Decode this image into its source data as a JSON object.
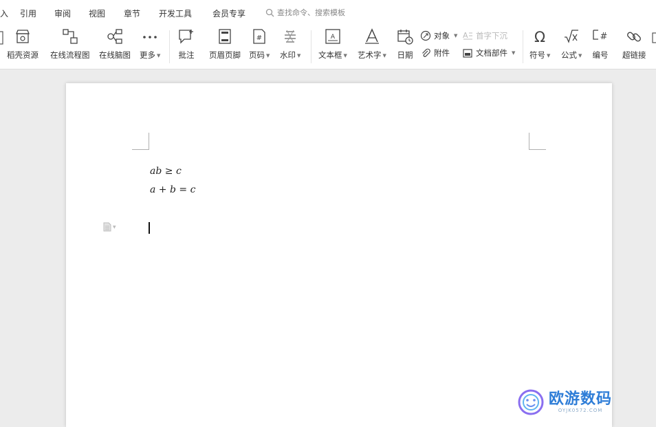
{
  "menu": {
    "items": [
      "引用",
      "审阅",
      "视图",
      "章节",
      "开发工具",
      "会员专享"
    ],
    "search_placeholder": "查找命令、搜索模板"
  },
  "ribbon": {
    "tools": [
      {
        "label": "稻壳资源",
        "icon": "template-store-icon"
      },
      {
        "label": "在线流程图",
        "icon": "flowchart-icon"
      },
      {
        "label": "在线脑图",
        "icon": "mindmap-icon"
      },
      {
        "label": "更多",
        "icon": "more-dots-icon",
        "dropdown": true
      },
      {
        "label": "批注",
        "icon": "comment-icon"
      },
      {
        "label": "页眉页脚",
        "icon": "header-footer-icon"
      },
      {
        "label": "页码",
        "icon": "page-number-icon",
        "dropdown": true
      },
      {
        "label": "水印",
        "icon": "watermark-icon",
        "dropdown": true
      },
      {
        "label": "文本框",
        "icon": "textbox-icon",
        "dropdown": true
      },
      {
        "label": "艺术字",
        "icon": "wordart-icon",
        "dropdown": true
      },
      {
        "label": "日期",
        "icon": "date-icon"
      },
      {
        "label": "符号",
        "icon": "omega-symbol-icon",
        "dropdown": true
      },
      {
        "label": "公式",
        "icon": "formula-icon",
        "dropdown": true
      },
      {
        "label": "编号",
        "icon": "numbering-icon"
      },
      {
        "label": "超链接",
        "icon": "hyperlink-icon"
      }
    ],
    "small_tools": {
      "object": "对象",
      "first_letter": "首字下沉",
      "attachment": "附件",
      "doc_parts": "文档部件"
    }
  },
  "document": {
    "equations": [
      "ab ≥ c",
      "a + b = c"
    ]
  },
  "watermark": {
    "title": "欧游数码",
    "subtitle": "OYJK0572.COM"
  }
}
